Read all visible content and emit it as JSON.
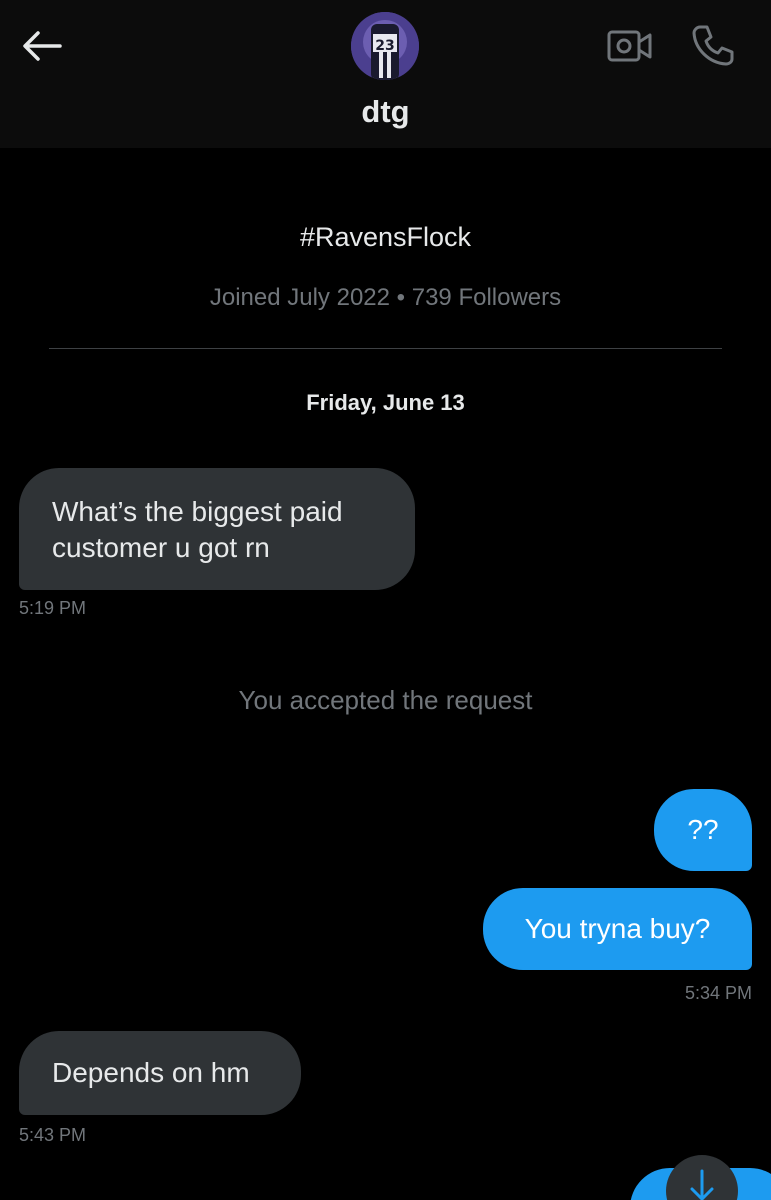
{
  "header": {
    "name": "dtg",
    "back_icon": "arrow-left-icon",
    "video_icon": "video-camera-icon",
    "call_icon": "phone-icon",
    "avatar_jersey_number": "23"
  },
  "profile": {
    "bio": "#RavensFlock",
    "meta": "Joined July 2022 • 739 Followers"
  },
  "conversation": {
    "date_separator": "Friday, June 13",
    "system_message": "You accepted the request",
    "messages": [
      {
        "direction": "in",
        "text_lines": [
          "What’s the biggest paid",
          "customer u got rn"
        ],
        "time": "5:19 PM"
      },
      {
        "direction": "out",
        "text": "??",
        "time": ""
      },
      {
        "direction": "out",
        "text": "You tryna buy?",
        "time": "5:34 PM"
      },
      {
        "direction": "in",
        "text": "Depends on hm",
        "time": "5:43 PM"
      }
    ]
  },
  "colors": {
    "background": "#000000",
    "header_bg": "#0c0c0c",
    "incoming_bubble": "#2f3336",
    "outgoing_bubble": "#1d9bf0",
    "secondary_text": "#71767b"
  },
  "controls": {
    "scroll_down_icon": "arrow-down-icon"
  }
}
